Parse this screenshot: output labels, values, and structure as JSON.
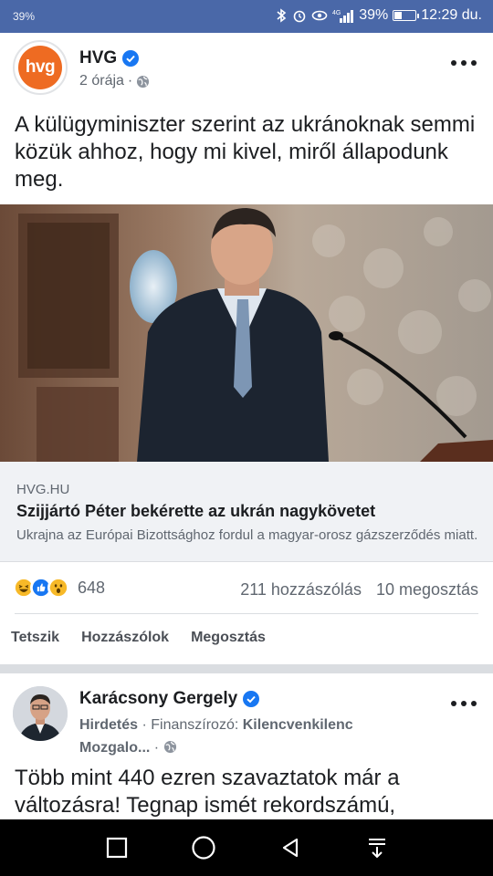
{
  "status_bar": {
    "left_text": "39%",
    "battery_pct_text": "39%",
    "battery_level": 0.39,
    "time": "12:29 du.",
    "network": "4G"
  },
  "post1": {
    "page_name": "HVG",
    "avatar_text": "hvg",
    "time": "2 órája",
    "separator": "·",
    "text": "A külügyminiszter szerint az ukránoknak semmi közük ahhoz, hogy mi kivel, miről állapodunk meg.",
    "link": {
      "domain": "HVG.HU",
      "title": "Szijjártó Péter bekérette az ukrán nagykövetet",
      "description": "Ukrajna az Európai Bizottsághoz fordul a magyar-orosz gázszerződés miatt."
    },
    "reactions": {
      "count": "648",
      "comments": "211 hozzászólás",
      "shares": "10 megosztás"
    },
    "actions": {
      "like": "Tetszik",
      "comment": "Hozzászólok",
      "share": "Megosztás"
    }
  },
  "post2": {
    "page_name": "Karácsony Gergely",
    "sponsored": "Hirdetés",
    "funder_label": "· Finanszírozó:",
    "funder_name": "Kilencvenkilenc",
    "funder_name_cont": "Mozgalo...",
    "separator": "·",
    "text": "Több mint 440 ezren szavaztatok már a változásra! Tegnap ismét rekordszámú,"
  },
  "colors": {
    "status_bar": "#4a68a8",
    "hvg_orange": "#ee6b22",
    "facebook_blue": "#1877f2",
    "secondary_text": "#606770"
  }
}
